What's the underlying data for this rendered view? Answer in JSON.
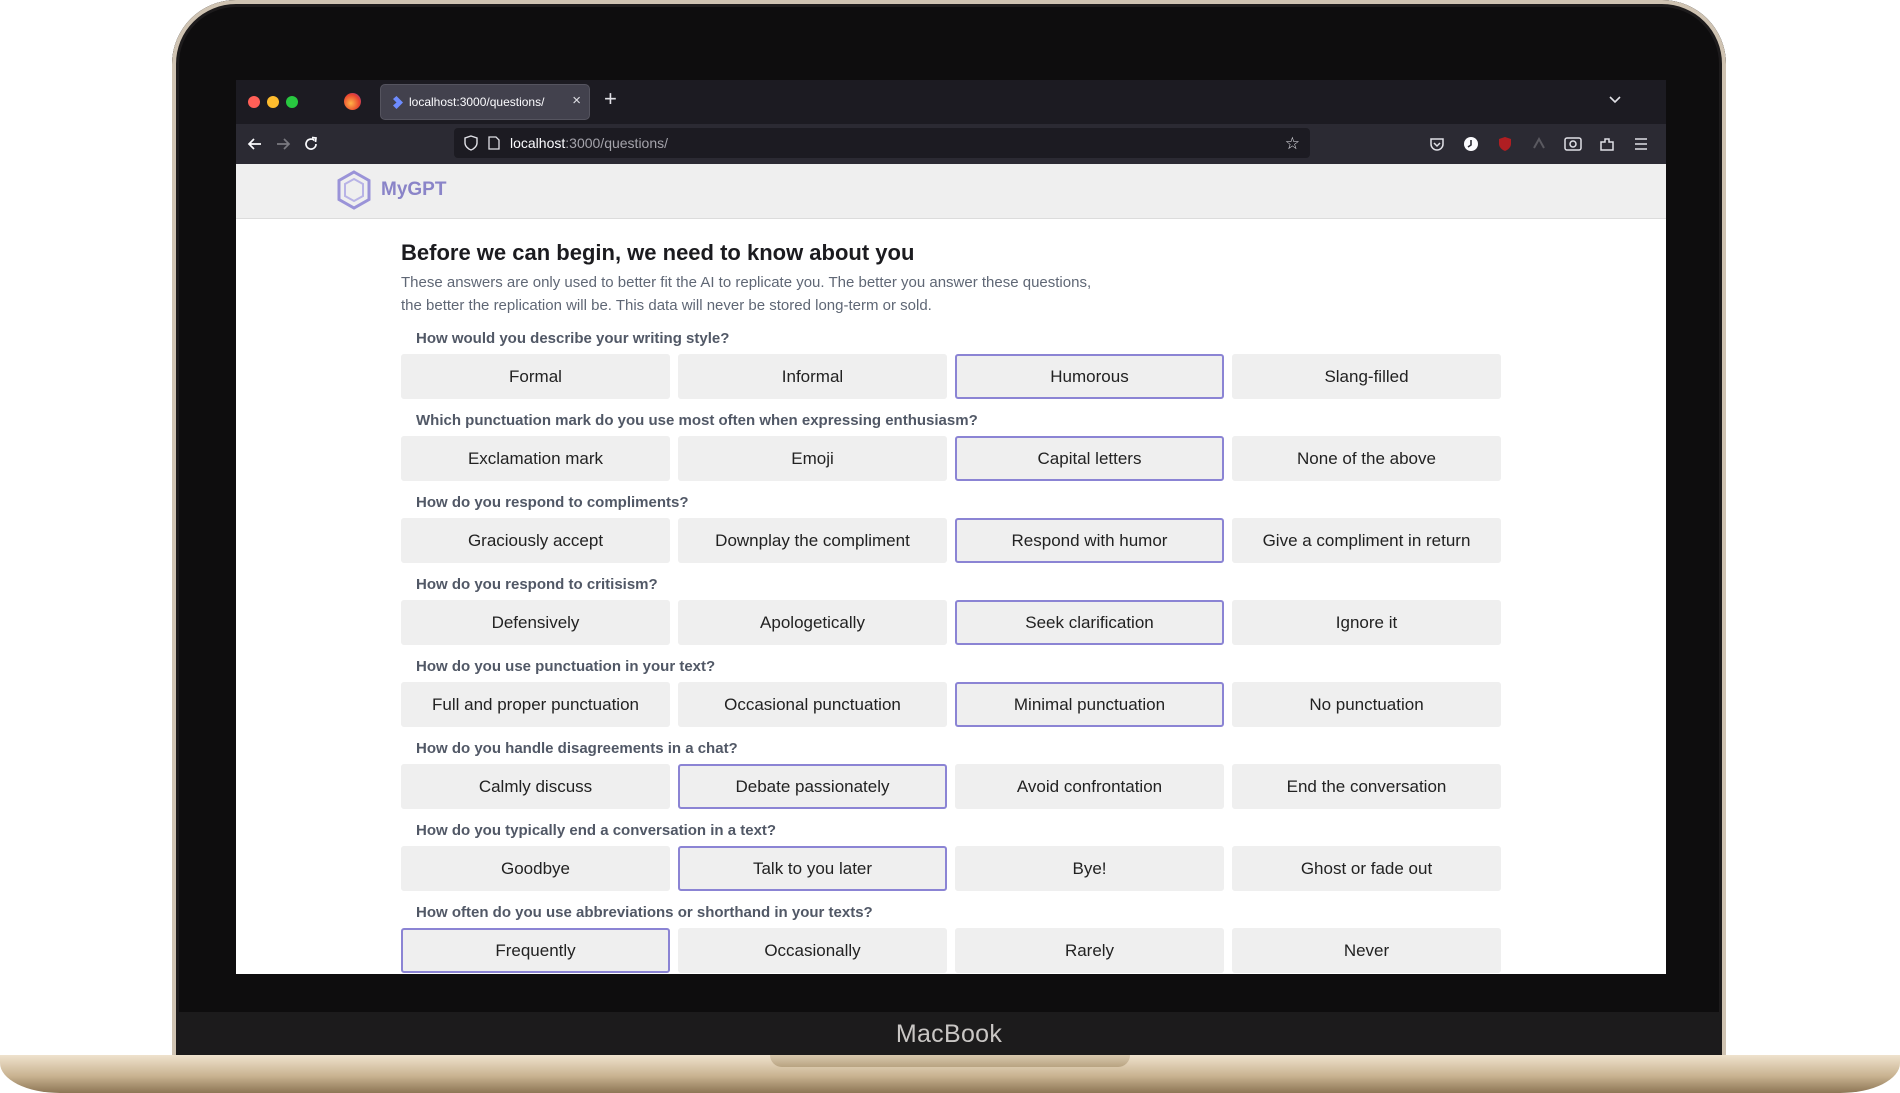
{
  "device_label": "MacBook",
  "browser": {
    "tab_title": "localhost:3000/questions/",
    "new_tab_symbol": "+",
    "close_symbol": "×",
    "url_host": "localhost",
    "url_path": ":3000/questions/"
  },
  "app": {
    "brand": "MyGPT",
    "accent_color": "#8b84d4"
  },
  "page": {
    "heading": "Before we can begin, we need to know about you",
    "intro": "These answers are only used to better fit the AI to replicate you. The better you answer these questions, the better the replication will be. This data will never be stored long-term or sold."
  },
  "questions": [
    {
      "text": "How would you describe your writing style?",
      "options": [
        "Formal",
        "Informal",
        "Humorous",
        "Slang-filled"
      ],
      "selected": 2
    },
    {
      "text": "Which punctuation mark do you use most often when expressing enthusiasm?",
      "options": [
        "Exclamation mark",
        "Emoji",
        "Capital letters",
        "None of the above"
      ],
      "selected": 2
    },
    {
      "text": "How do you respond to compliments?",
      "options": [
        "Graciously accept",
        "Downplay the compliment",
        "Respond with humor",
        "Give a compliment in return"
      ],
      "selected": 2
    },
    {
      "text": "How do you respond to critisism?",
      "options": [
        "Defensively",
        "Apologetically",
        "Seek clarification",
        "Ignore it"
      ],
      "selected": 2
    },
    {
      "text": "How do you use punctuation in your text?",
      "options": [
        "Full and proper punctuation",
        "Occasional punctuation",
        "Minimal punctuation",
        "No punctuation"
      ],
      "selected": 2
    },
    {
      "text": "How do you handle disagreements in a chat?",
      "options": [
        "Calmly discuss",
        "Debate passionately",
        "Avoid confrontation",
        "End the conversation"
      ],
      "selected": 1
    },
    {
      "text": "How do you typically end a conversation in a text?",
      "options": [
        "Goodbye",
        "Talk to you later",
        "Bye!",
        "Ghost or fade out"
      ],
      "selected": 1
    },
    {
      "text": "How often do you use abbreviations or shorthand in your texts?",
      "options": [
        "Frequently",
        "Occasionally",
        "Rarely",
        "Never"
      ],
      "selected": 0
    }
  ]
}
